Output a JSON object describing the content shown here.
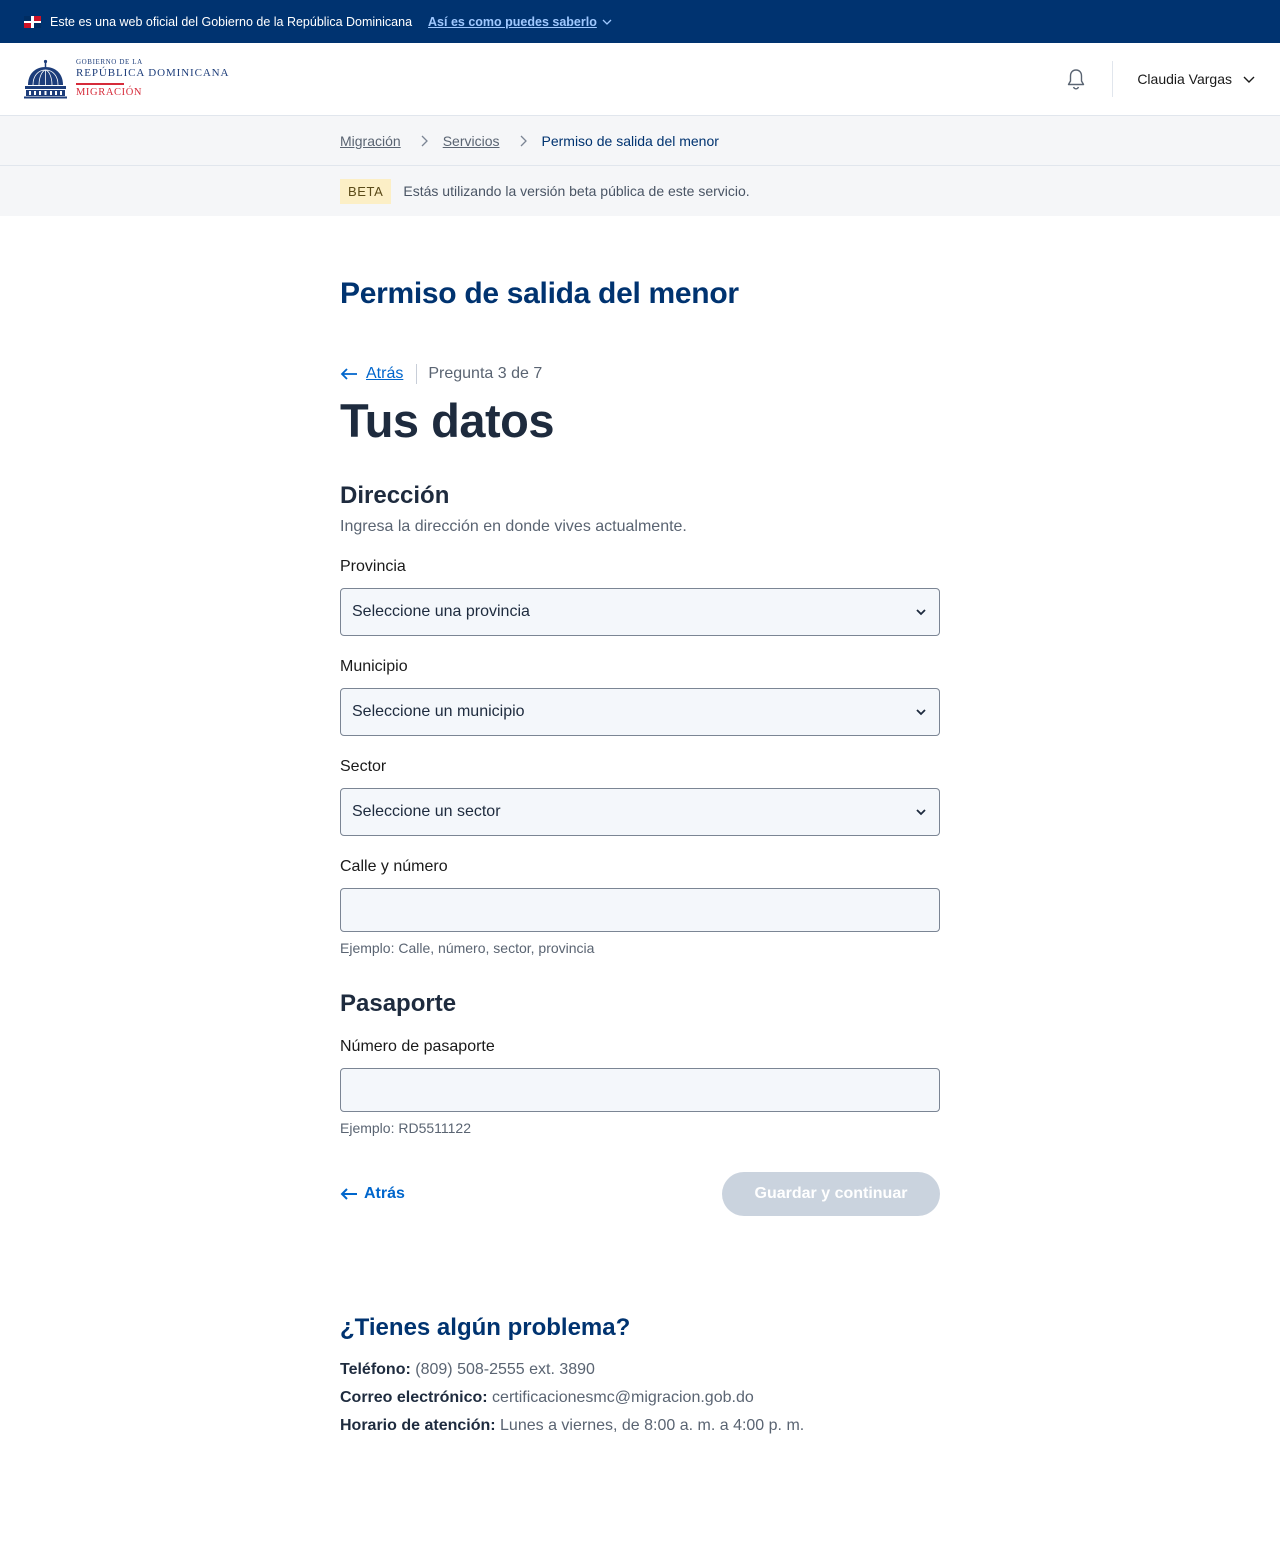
{
  "topbar": {
    "official_text": "Este es una web oficial del Gobierno de la República Dominicana",
    "howto_link": "Así es como puedes saberlo"
  },
  "header": {
    "logo": {
      "gob": "Gobierno de la",
      "republica": "República Dominicana",
      "migracion": "Migración"
    },
    "user_name": "Claudia Vargas"
  },
  "breadcrumb": {
    "items": [
      "Migración",
      "Servicios"
    ],
    "current": "Permiso de salida del menor"
  },
  "beta": {
    "tag": "BETA",
    "text": "Estás utilizando la versión beta pública de este servicio."
  },
  "main": {
    "service_title": "Permiso de salida del menor",
    "back_label": "Atrás",
    "step_text": "Pregunta 3 de 7",
    "page_title": "Tus datos"
  },
  "address": {
    "title": "Dirección",
    "description": "Ingresa la dirección en donde vives actualmente.",
    "provincia_label": "Provincia",
    "provincia_value": "Seleccione una provincia",
    "municipio_label": "Municipio",
    "municipio_value": "Seleccione un municipio",
    "sector_label": "Sector",
    "sector_value": "Seleccione un sector",
    "street_label": "Calle y número",
    "street_value": "",
    "street_hint": "Ejemplo: Calle, número, sector, provincia"
  },
  "passport": {
    "title": "Pasaporte",
    "number_label": "Número de pasaporte",
    "number_value": "",
    "number_hint": "Ejemplo: RD5511122"
  },
  "actions": {
    "back_label": "Atrás",
    "save_label": "Guardar y continuar"
  },
  "help": {
    "title": "¿Tienes algún problema?",
    "phone_label": "Teléfono:",
    "phone_value": "(809) 508-2555 ext. 3890",
    "email_label": "Correo electrónico:",
    "email_value": "certificacionesmc@migracion.gob.do",
    "hours_label": "Horario de atención:",
    "hours_value": "Lunes a viernes, de 8:00 a. m. a 4:00 p. m."
  },
  "colors": {
    "brand_navy": "#003370",
    "link_blue": "#0066cc",
    "accent_red": "#d62b3a",
    "disabled_button": "#cad3de"
  }
}
